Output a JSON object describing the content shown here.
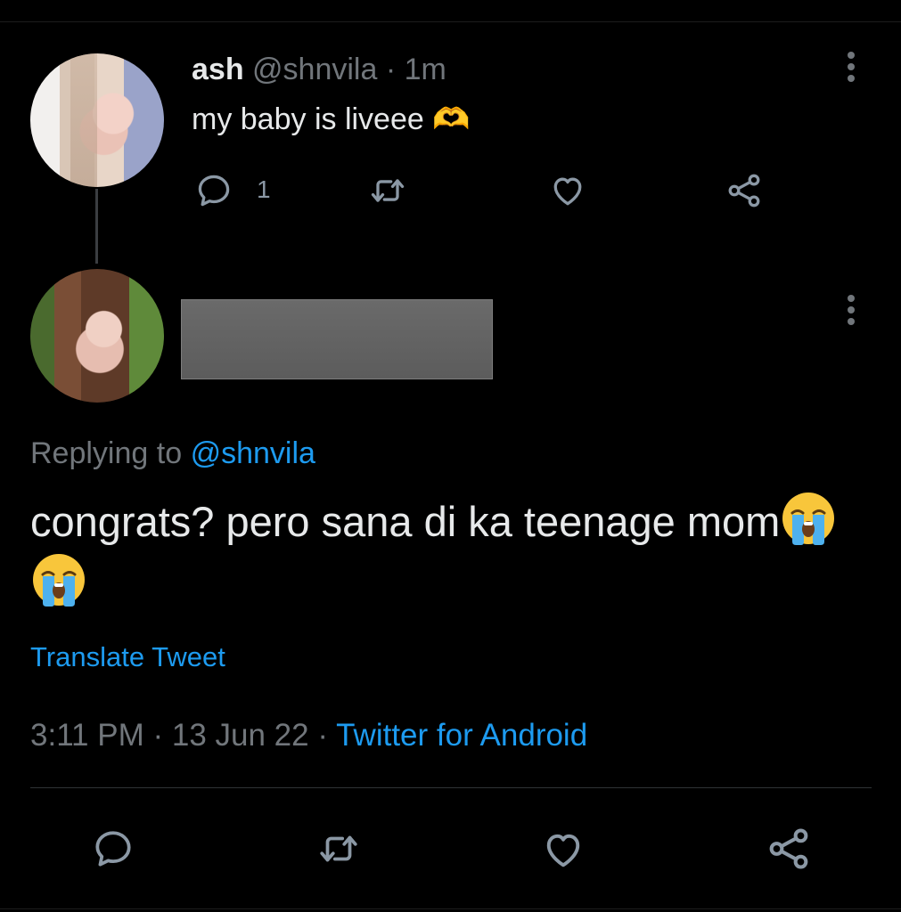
{
  "parent_tweet": {
    "author_name": "ash",
    "author_handle": "@shnvila",
    "separator": "·",
    "time_ago": "1m",
    "text": "my baby is liveee 🫶",
    "reply_count": "1"
  },
  "reply_tweet": {
    "replying_prefix": "Replying to",
    "replying_to": "@shnvila",
    "text": "congrats? pero sana di ka teenage mom",
    "emojis": [
      "loudly-crying-face",
      "loudly-crying-face"
    ],
    "translate_label": "Translate Tweet",
    "time": "3:11 PM",
    "separator": "·",
    "date": "13 Jun 22",
    "source": "Twitter for Android"
  },
  "colors": {
    "background": "#000000",
    "text": "#e7e9ea",
    "secondary": "#71767b",
    "accent": "#1d9bf0",
    "icon": "#8b98a5"
  }
}
